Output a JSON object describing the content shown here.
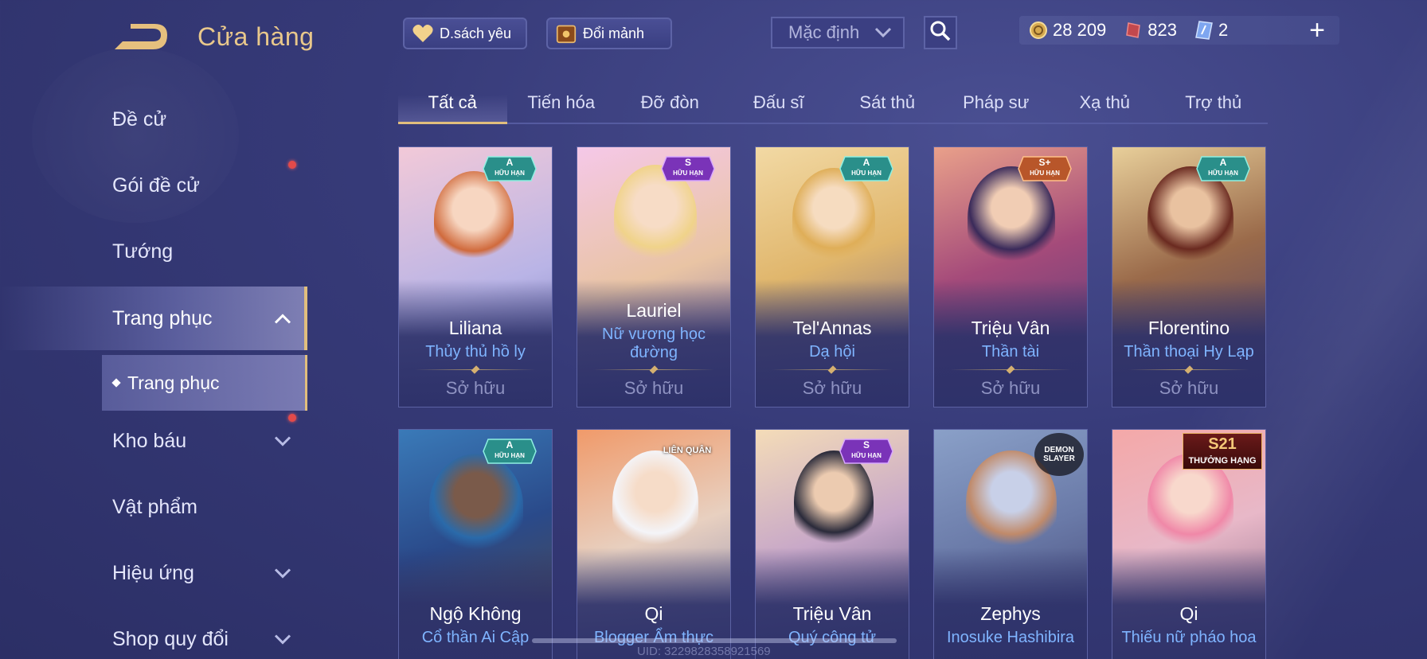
{
  "header": {
    "title": "Cửa hàng",
    "wishlist_label": "D.sách yêu",
    "fragments_label": "Đổi mảnh",
    "sort_value": "Mặc định"
  },
  "currency": {
    "gold": "28 209",
    "vouchers": "823",
    "tickets": "2"
  },
  "sidebar": {
    "items": [
      {
        "label": "Đề cử"
      },
      {
        "label": "Gói đề cử"
      },
      {
        "label": "Tướng"
      },
      {
        "label": "Trang phục"
      },
      {
        "label": "Kho báu"
      },
      {
        "label": "Vật phẩm"
      },
      {
        "label": "Hiệu ứng"
      },
      {
        "label": "Shop quy đổi"
      }
    ],
    "sub_item": "Trang phục"
  },
  "tabs": [
    "Tất cả",
    "Tiến hóa",
    "Đỡ đòn",
    "Đấu sĩ",
    "Sát thủ",
    "Pháp sư",
    "Xạ thủ",
    "Trợ thủ"
  ],
  "cards": [
    {
      "hero": "Liliana",
      "skin": "Thủy thủ hồ ly",
      "status": "Sở hữu",
      "rank": "A",
      "badge_label": "HỮU HẠN"
    },
    {
      "hero": "Lauriel",
      "skin": "Nữ vương học đường",
      "status": "Sở hữu",
      "rank": "S",
      "badge_label": "HỮU HẠN"
    },
    {
      "hero": "Tel'Annas",
      "skin": "Dạ hội",
      "status": "Sở hữu",
      "rank": "A",
      "badge_label": "HỮU HẠN"
    },
    {
      "hero": "Triệu Vân",
      "skin": "Thần tài",
      "status": "Sở hữu",
      "rank": "S+",
      "badge_label": "HỮU HẠN"
    },
    {
      "hero": "Florentino",
      "skin": "Thần thoại Hy Lạp",
      "status": "Sở hữu",
      "rank": "A",
      "badge_label": "HỮU HẠN"
    },
    {
      "hero": "Ngộ Không",
      "skin": "Cổ thần Ai Cập",
      "rank": "A",
      "badge_label": "HỮU HẠN"
    },
    {
      "hero": "Qi",
      "skin": "Blogger Ẩm thực",
      "badge_label": "LIÊN QUÂN"
    },
    {
      "hero": "Triệu Vân",
      "skin": "Quý công tử",
      "rank": "S",
      "badge_label": "HỮU HẠN"
    },
    {
      "hero": "Zephys",
      "skin": "Inosuke Hashibira",
      "badge_label": "DEMON SLAYER"
    },
    {
      "hero": "Qi",
      "skin": "Thiếu nữ pháo hoa",
      "rank": "S21",
      "badge_label": "THƯỞNG HẠNG"
    }
  ],
  "footer": {
    "uid": "UID: 3229828358921569"
  }
}
